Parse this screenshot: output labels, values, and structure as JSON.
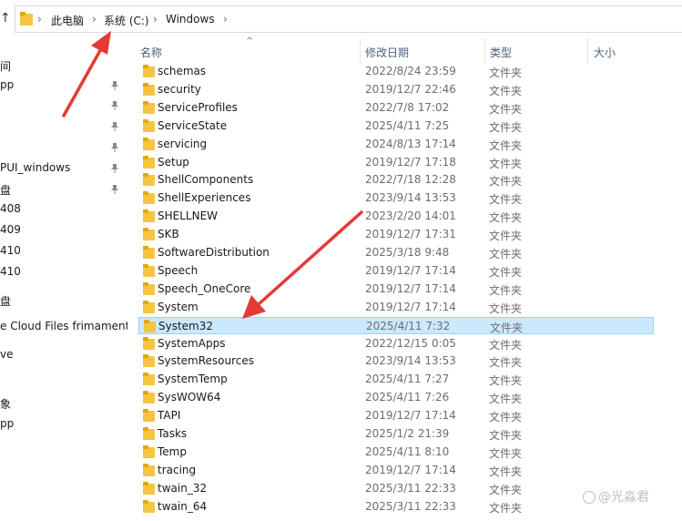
{
  "address": {
    "up_icon": "up-arrow-icon",
    "crumbs": [
      "此电脑",
      "系统 (C:)",
      "Windows"
    ],
    "chevron": "›"
  },
  "nav": {
    "items": [
      "间",
      "pp",
      "PUI_windows",
      "盘",
      "408",
      "409",
      "410",
      "410",
      "盘",
      "e Cloud Files  frimament0",
      "ve",
      "象",
      "pp"
    ],
    "pinned_count": 6
  },
  "columns": {
    "name": "名称",
    "date": "修改日期",
    "type": "类型",
    "size": "大小"
  },
  "files": [
    {
      "name": "schemas",
      "date": "2022/8/24 23:59",
      "type": "文件夹"
    },
    {
      "name": "security",
      "date": "2019/12/7 22:46",
      "type": "文件夹"
    },
    {
      "name": "ServiceProfiles",
      "date": "2022/7/8 17:02",
      "type": "文件夹"
    },
    {
      "name": "ServiceState",
      "date": "2025/4/11 7:25",
      "type": "文件夹"
    },
    {
      "name": "servicing",
      "date": "2024/8/13 17:14",
      "type": "文件夹"
    },
    {
      "name": "Setup",
      "date": "2019/12/7 17:18",
      "type": "文件夹"
    },
    {
      "name": "ShellComponents",
      "date": "2022/7/18 12:28",
      "type": "文件夹"
    },
    {
      "name": "ShellExperiences",
      "date": "2023/9/14 13:53",
      "type": "文件夹"
    },
    {
      "name": "SHELLNEW",
      "date": "2023/2/20 14:01",
      "type": "文件夹"
    },
    {
      "name": "SKB",
      "date": "2019/12/7 17:31",
      "type": "文件夹"
    },
    {
      "name": "SoftwareDistribution",
      "date": "2025/3/18 9:48",
      "type": "文件夹"
    },
    {
      "name": "Speech",
      "date": "2019/12/7 17:14",
      "type": "文件夹"
    },
    {
      "name": "Speech_OneCore",
      "date": "2019/12/7 17:14",
      "type": "文件夹"
    },
    {
      "name": "System",
      "date": "2019/12/7 17:14",
      "type": "文件夹"
    },
    {
      "name": "System32",
      "date": "2025/4/11 7:32",
      "type": "文件夹",
      "selected": true
    },
    {
      "name": "SystemApps",
      "date": "2022/12/15 0:05",
      "type": "文件夹"
    },
    {
      "name": "SystemResources",
      "date": "2023/9/14 13:53",
      "type": "文件夹"
    },
    {
      "name": "SystemTemp",
      "date": "2025/4/11 7:27",
      "type": "文件夹"
    },
    {
      "name": "SysWOW64",
      "date": "2025/4/11 7:26",
      "type": "文件夹"
    },
    {
      "name": "TAPI",
      "date": "2019/12/7 17:14",
      "type": "文件夹"
    },
    {
      "name": "Tasks",
      "date": "2025/1/2 21:39",
      "type": "文件夹"
    },
    {
      "name": "Temp",
      "date": "2025/4/11 8:10",
      "type": "文件夹"
    },
    {
      "name": "tracing",
      "date": "2019/12/7 17:14",
      "type": "文件夹"
    },
    {
      "name": "twain_32",
      "date": "2025/3/11 22:33",
      "type": "文件夹"
    },
    {
      "name": "twain_64",
      "date": "2025/3/11 22:33",
      "type": "文件夹"
    }
  ],
  "watermark": "@光淼君",
  "colors": {
    "folder": "#f5c542",
    "folder_dark": "#e0a800",
    "selection_bg": "#cce8ff",
    "selection_border": "#99d1ff",
    "arrow": "#e53935",
    "header_text": "#4c607a"
  }
}
